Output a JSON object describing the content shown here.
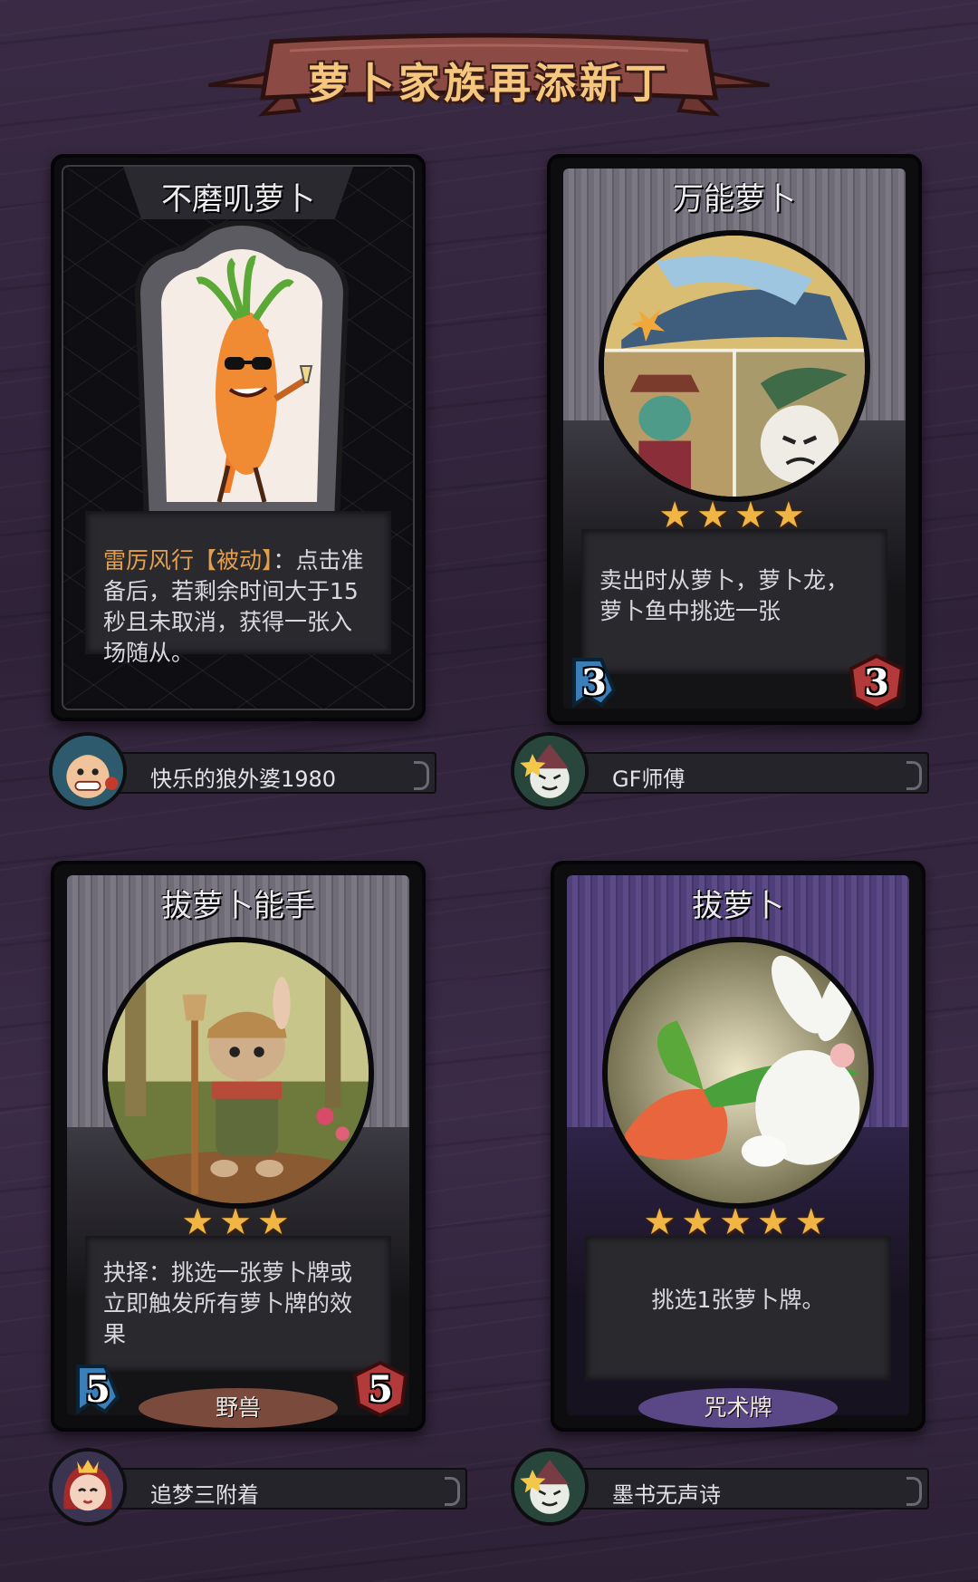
{
  "banner": {
    "title": "萝卜家族再添新丁"
  },
  "cards": [
    {
      "title": "不磨叽萝卜",
      "desc_keyword": "雷厉风行【被动】",
      "desc_text": "：点击准备后，若剩余时间大于15秒且未取消，获得一张入场随从。",
      "author": "快乐的狼外婆1980"
    },
    {
      "title": "万能萝卜",
      "stars": "★★★★",
      "desc_text": "卖出时从萝卜，萝卜龙，萝卜鱼中挑选一张",
      "cost": "3",
      "attack": "3",
      "author": "GF师傅"
    },
    {
      "title": "拔萝卜能手",
      "stars": "★★★",
      "desc_text": "抉择：挑选一张萝卜牌或立即触发所有萝卜牌的效果",
      "cost": "5",
      "attack": "5",
      "tag": "野兽",
      "author": "追梦三附着"
    },
    {
      "title": "拔萝卜",
      "stars": "★★★★★",
      "desc_text": "挑选1张萝卜牌。",
      "tag": "咒术牌",
      "author": "墨书无声诗"
    }
  ],
  "colors": {
    "keyword": "#e2a04e",
    "stars": "#f0b545",
    "banner_text": "#f5c77e",
    "banner_ribbon": "#8c4a44",
    "background": "#342640"
  },
  "icons": [
    "ribbon-banner",
    "star-icon",
    "cost-badge-icon",
    "attack-badge-icon",
    "avatar-icon"
  ]
}
